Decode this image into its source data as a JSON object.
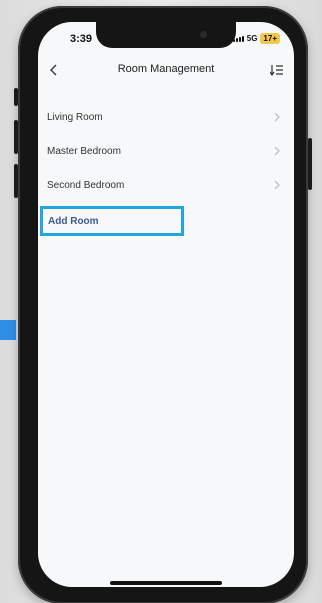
{
  "status_bar": {
    "time": "3:39",
    "network": "5G",
    "battery": "17+"
  },
  "nav": {
    "title": "Room Management",
    "back_icon": "chevron-left-icon",
    "sort_icon": "sort-icon"
  },
  "rooms": [
    {
      "label": "Living Room"
    },
    {
      "label": "Master Bedroom"
    },
    {
      "label": "Second Bedroom"
    }
  ],
  "add_room": {
    "label": "Add Room",
    "highlight_color": "#23a6e0",
    "text_color": "#3b5b93"
  },
  "colors": {
    "background_accent": "#2f8fe6",
    "screen_bg": "#f7f8fa"
  }
}
